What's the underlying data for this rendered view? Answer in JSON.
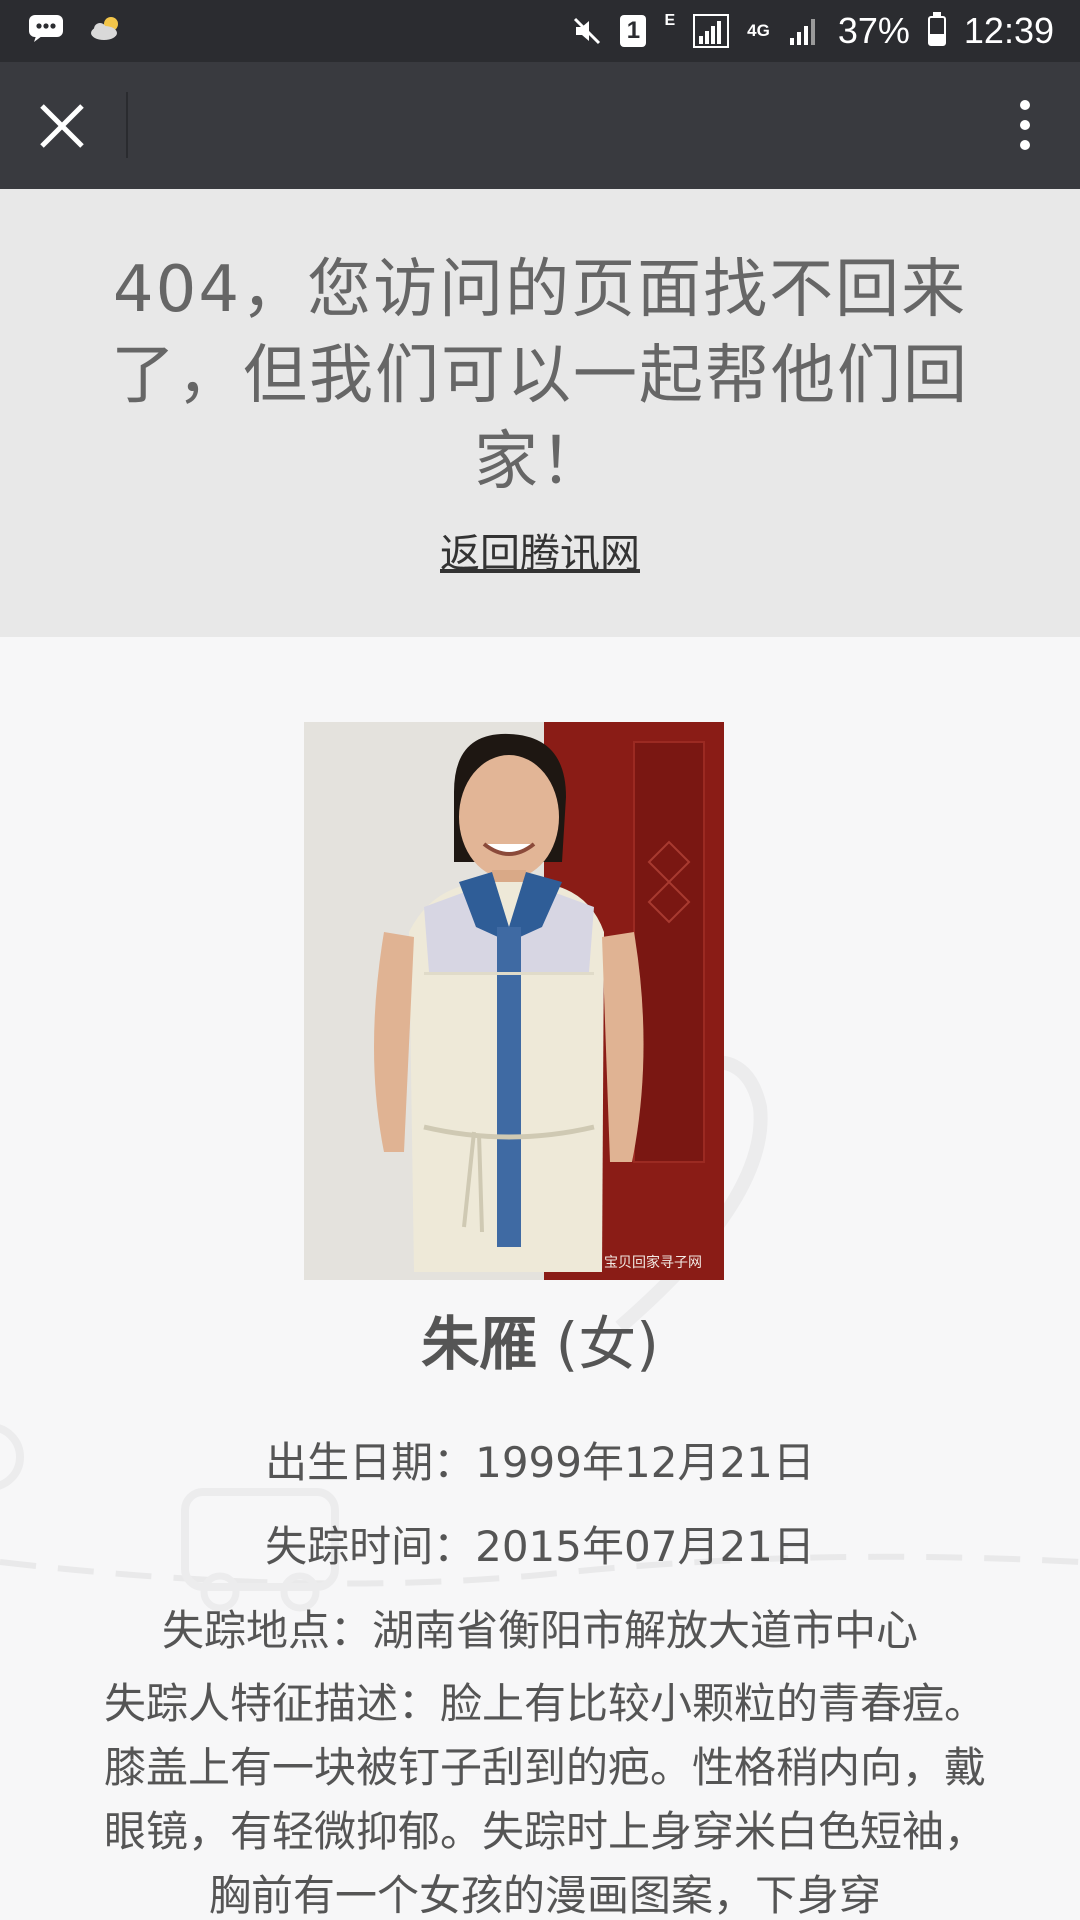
{
  "status_bar": {
    "battery_percent": "37%",
    "time": "12:39",
    "sim_slot": "1",
    "network_e": "E",
    "network_4g": "4G",
    "battery_level": 0.37
  },
  "nav": {
    "icons": [
      "close-icon",
      "more-vertical-icon"
    ]
  },
  "banner": {
    "title": "404，您访问的页面找不回来了，但我们可以一起帮他们回家！",
    "home_link": "返回腾讯网"
  },
  "person": {
    "name": "朱雁",
    "gender": "(女)",
    "photo_watermark": "宝贝回家寻子网",
    "birth_date": "出生日期：1999年12月21日",
    "missing_time": "失踪时间：2015年07月21日",
    "missing_place": "失踪地点：湖南省衡阳市解放大道市中心",
    "description": "失踪人特征描述：脸上有比较小颗粒的青春痘。膝盖上有一块被钉子刮到的疤。性格稍内向，戴眼镜，有轻微抑郁。失踪时上身穿米白色短袖，胸前有一个女孩的漫画图案，下身穿"
  },
  "colors": {
    "status_bar_bg": "#2b2c30",
    "nav_bar_bg": "#393a3f",
    "banner_bg": "#e8e8e8",
    "content_bg": "#f7f7f8",
    "text_gray": "#555555"
  }
}
